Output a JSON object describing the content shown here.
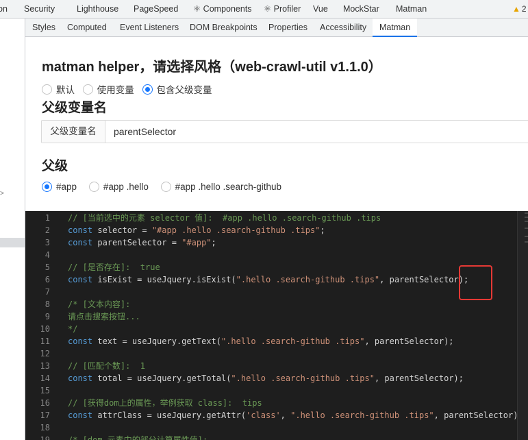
{
  "top_tabs": [
    "on",
    "Security",
    "Lighthouse",
    "PageSpeed",
    "⚛ Components",
    "⚛ Profiler",
    "Vue",
    "MockStar",
    "Matman"
  ],
  "warning_count": "2",
  "sub_tabs": [
    "Styles",
    "Computed",
    "Event Listeners",
    "DOM Breakpoints",
    "Properties",
    "Accessibility",
    "Matman"
  ],
  "active_sub_tab": "Matman",
  "helper": {
    "title": "matman helper，请选择风格（web-crawl-util v1.1.0）",
    "styles": [
      {
        "label": "默认",
        "checked": false
      },
      {
        "label": "使用变量",
        "checked": false
      },
      {
        "label": "包含父级变量",
        "checked": true
      }
    ],
    "parent_var_section": "父级变量名",
    "parent_var_addon": "父级变量名",
    "parent_var_value": "parentSelector",
    "parent_section": "父级",
    "parents": [
      {
        "label": "#app",
        "checked": true
      },
      {
        "label": "#app .hello",
        "checked": false
      },
      {
        "label": "#app .hello .search-github",
        "checked": false
      }
    ]
  },
  "code_lines": [
    {
      "n": "1",
      "parts": [
        [
          "c-com",
          "// [当前选中的元素 selector 值]:  #app .hello .search-github .tips"
        ]
      ]
    },
    {
      "n": "2",
      "parts": [
        [
          "c-kw",
          "const"
        ],
        [
          "c-var",
          " selector = "
        ],
        [
          "c-str",
          "\"#app .hello .search-github .tips\""
        ],
        [
          "c-var",
          ";"
        ]
      ]
    },
    {
      "n": "3",
      "parts": [
        [
          "c-kw",
          "const"
        ],
        [
          "c-var",
          " parentSelector = "
        ],
        [
          "c-str",
          "\"#app\""
        ],
        [
          "c-var",
          ";"
        ]
      ]
    },
    {
      "n": "4",
      "parts": []
    },
    {
      "n": "5",
      "parts": [
        [
          "c-com",
          "// [是否存在]:  true"
        ]
      ]
    },
    {
      "n": "6",
      "parts": [
        [
          "c-kw",
          "const"
        ],
        [
          "c-var",
          " isExist = useJquery.isExist("
        ],
        [
          "c-str",
          "\".hello .search-github .tips\""
        ],
        [
          "c-var",
          ", parentSelector);"
        ]
      ]
    },
    {
      "n": "7",
      "parts": []
    },
    {
      "n": "8",
      "parts": [
        [
          "c-com",
          "/* [文本内容]:"
        ]
      ]
    },
    {
      "n": "9",
      "parts": [
        [
          "c-com",
          "请点击搜索按钮..."
        ]
      ]
    },
    {
      "n": "10",
      "parts": [
        [
          "c-com",
          "*/"
        ]
      ]
    },
    {
      "n": "11",
      "parts": [
        [
          "c-kw",
          "const"
        ],
        [
          "c-var",
          " text = useJquery.getText("
        ],
        [
          "c-str",
          "\".hello .search-github .tips\""
        ],
        [
          "c-var",
          ", parentSelector);"
        ]
      ]
    },
    {
      "n": "12",
      "parts": []
    },
    {
      "n": "13",
      "parts": [
        [
          "c-com",
          "// [匹配个数]:  1"
        ]
      ]
    },
    {
      "n": "14",
      "parts": [
        [
          "c-kw",
          "const"
        ],
        [
          "c-var",
          " total = useJquery.getTotal("
        ],
        [
          "c-str",
          "\".hello .search-github .tips\""
        ],
        [
          "c-var",
          ", parentSelector);"
        ]
      ]
    },
    {
      "n": "15",
      "parts": []
    },
    {
      "n": "16",
      "parts": [
        [
          "c-com",
          "// [获得dom上的属性，举例获取 class]:  tips"
        ]
      ]
    },
    {
      "n": "17",
      "parts": [
        [
          "c-kw",
          "const"
        ],
        [
          "c-var",
          " attrClass = useJquery.getAttr("
        ],
        [
          "c-str",
          "'class'"
        ],
        [
          "c-var",
          ", "
        ],
        [
          "c-str",
          "\".hello .search-github .tips\""
        ],
        [
          "c-var",
          ", parentSelector)"
        ]
      ]
    },
    {
      "n": "18",
      "parts": []
    },
    {
      "n": "19",
      "parts": [
        [
          "c-com",
          "/* [dom 元素中的部分计算属性值]:"
        ]
      ]
    }
  ]
}
